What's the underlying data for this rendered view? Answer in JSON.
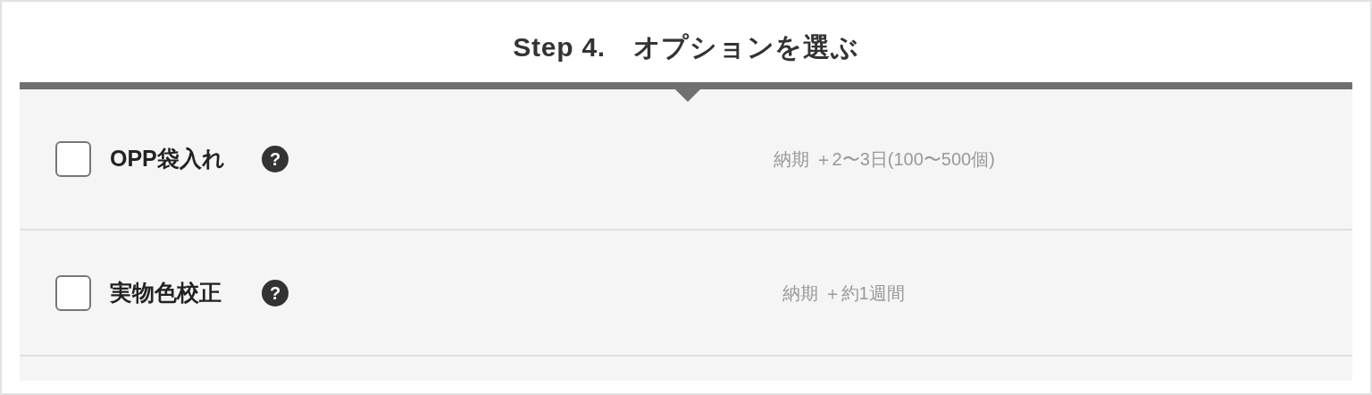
{
  "section": {
    "title": "Step 4.　オプションを選ぶ"
  },
  "options": [
    {
      "label": "OPP袋入れ",
      "checked": false,
      "help": "?",
      "delivery": "納期 ＋2〜3日(100〜500個)"
    },
    {
      "label": "実物色校正",
      "checked": false,
      "help": "?",
      "delivery": "納期 ＋約1週間"
    }
  ]
}
